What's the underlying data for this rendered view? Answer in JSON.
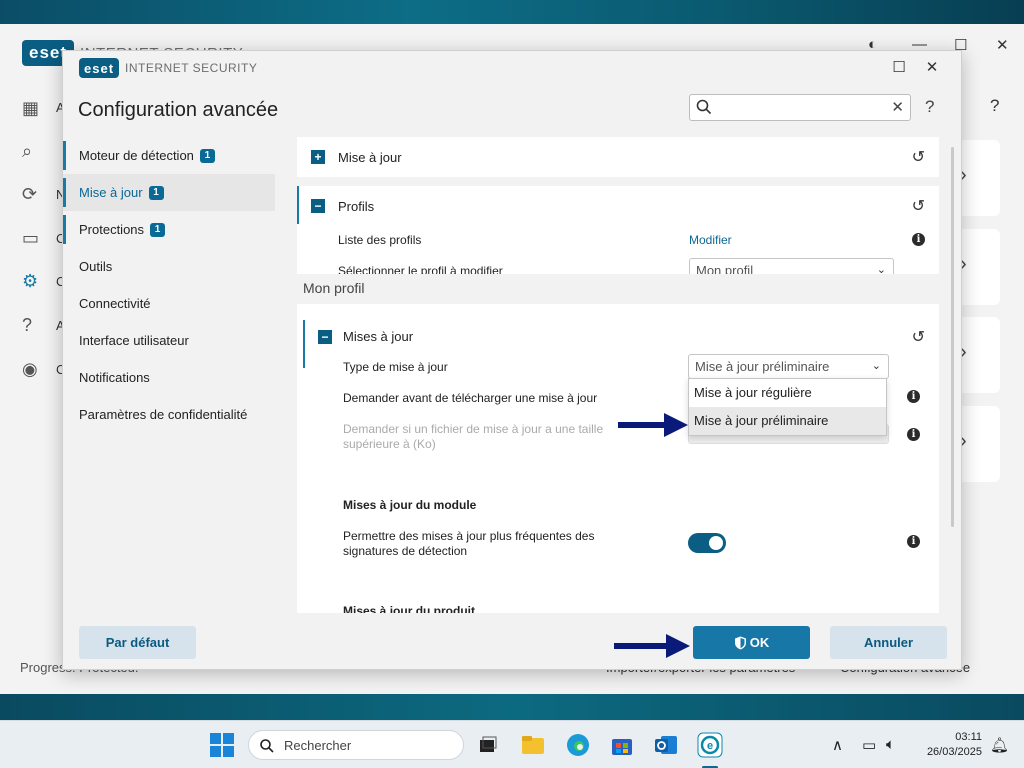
{
  "main_window": {
    "product_name": "INTERNET SECURITY",
    "logo_text": "eset",
    "nav_letters": [
      "A",
      "N",
      "C",
      "C",
      "A",
      "C"
    ],
    "help_label": "?",
    "status_text": "Progress. Protected.",
    "footer_links": [
      "Importer/exporter les paramètres",
      "Configuration avancée"
    ]
  },
  "dialog": {
    "logo_text": "eset",
    "product_name": "INTERNET SECURITY",
    "heading": "Configuration avancée",
    "search": {
      "value": "",
      "placeholder": ""
    },
    "help_label": "?"
  },
  "sidebar": {
    "items": [
      {
        "label": "Moteur de détection",
        "badge": "1"
      },
      {
        "label": "Mise à jour",
        "badge": "1"
      },
      {
        "label": "Protections",
        "badge": "1"
      },
      {
        "label": "Outils"
      },
      {
        "label": "Connectivité"
      },
      {
        "label": "Interface utilisateur"
      },
      {
        "label": "Notifications"
      },
      {
        "label": "Paramètres de confidentialité"
      }
    ]
  },
  "content": {
    "section_update": {
      "title": "Mise à jour",
      "toggle": "+"
    },
    "section_profiles": {
      "title": "Profils",
      "toggle": "−",
      "profile_list_label": "Liste des profils",
      "profile_list_action": "Modifier",
      "select_profile_label": "Sélectionner le profil à modifier",
      "select_profile_value": "Mon profil"
    },
    "profile_caption": "Mon profil",
    "updates": {
      "title": "Mises à jour",
      "toggle": "−",
      "type_label": "Type de mise à jour",
      "type_value": "Mise à jour préliminaire",
      "type_options": [
        "Mise à jour régulière",
        "Mise à jour préliminaire"
      ],
      "ask_before_label": "Demander avant de télécharger une mise à jour",
      "ask_size_label": "Demander si un fichier de mise à jour a une taille supérieure à (Ko)",
      "module_heading": "Mises à jour du module",
      "frequent_label": "Permettre des mises à jour plus fréquentes des signatures de détection",
      "frequent_enabled": true,
      "product_heading": "Mises à jour du produit"
    }
  },
  "footer": {
    "default_label": "Par défaut",
    "ok_label": "OK",
    "cancel_label": "Annuler"
  },
  "taskbar": {
    "search_label": "Rechercher",
    "time": "03:11",
    "date": "26/03/2025"
  },
  "colors": {
    "accent": "#0a5d83",
    "annotation_arrow": "#0a1a78"
  }
}
